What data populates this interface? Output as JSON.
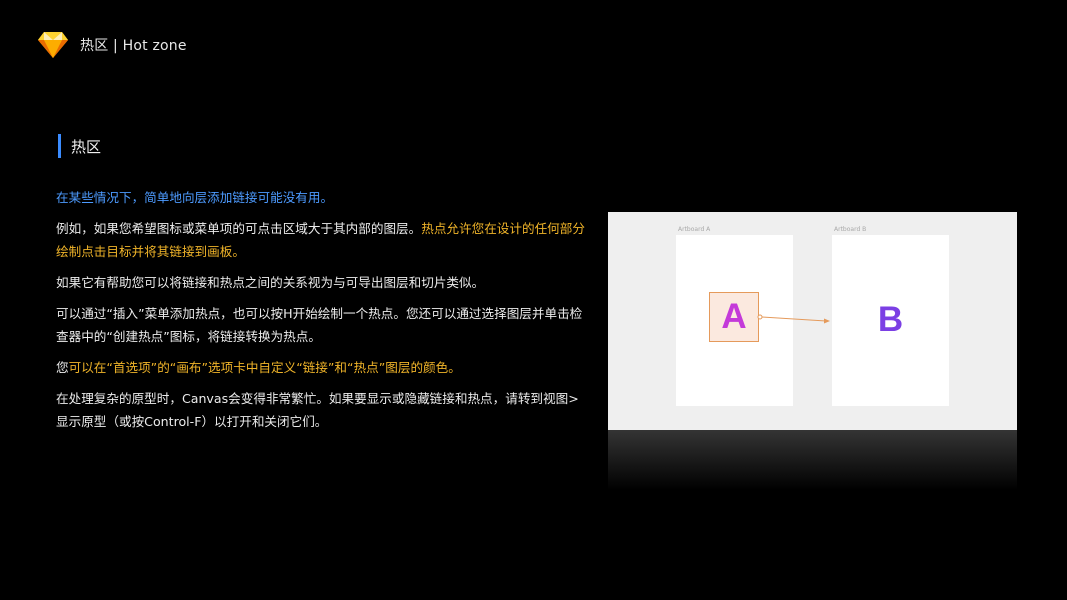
{
  "header": {
    "title": "热区 | Hot zone",
    "logo_icon": "sketch-diamond-icon"
  },
  "section": {
    "title": "热区",
    "accent_color": "#3b8cff"
  },
  "paragraphs": {
    "p1": "在某些情况下，简单地向层添加链接可能没有用。",
    "p2_plain": "例如，如果您希望图标或菜单项的可点击区域大于其内部的图层。",
    "p2_highlight": "热点允许您在设计的任何部分绘制点击目标并将其链接到画板。",
    "p3": "如果它有帮助您可以将链接和热点之间的关系视为与可导出图层和切片类似。",
    "p4": "可以通过“插入”菜单添加热点，也可以按H开始绘制一个热点。您还可以通过选择图层并单击检查器中的“创建热点”图标，将链接转换为热点。",
    "p5_plain": "您",
    "p5_highlight": "可以在“首选项”的“画布”选项卡中自定义“链接”和“热点”图层的颜色。",
    "p6": "在处理复杂的原型时，Canvas会变得非常繁忙。如果要显示或隐藏链接和热点，请转到视图>显示原型（或按Control-F）以打开和关闭它们。"
  },
  "figure": {
    "artboard_a_label": "Artboard A",
    "artboard_b_label": "Artboard B",
    "letter_a": "A",
    "letter_b": "B",
    "hotspot_color": "#e59a5b",
    "letter_a_color": "#c43ad9",
    "letter_b_color": "#7b3fe4"
  },
  "colors": {
    "highlight_blue": "#4d9bff",
    "highlight_orange": "#f0b429"
  }
}
